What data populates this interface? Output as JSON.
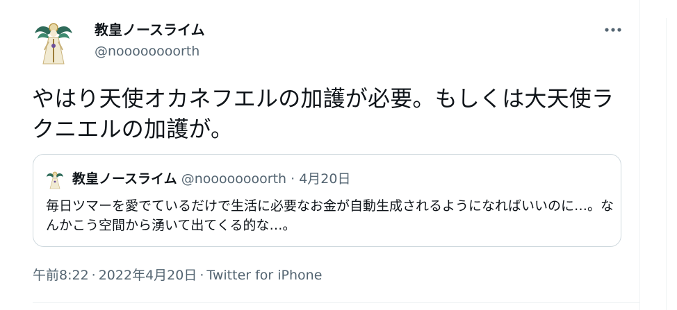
{
  "author": {
    "display_name": "教皇ノースライム",
    "handle": "@noooooooorth",
    "avatar_icon": "angel-figure-avatar"
  },
  "menu": {
    "more_icon": "more-horizontal-icon"
  },
  "tweet": {
    "text": "やはり天使オカネフエルの加護が必要。もしくは大天使ラクニエルの加護が。"
  },
  "quoted_tweet": {
    "display_name": "教皇ノースライム",
    "handle": "@noooooooorth",
    "separator": "·",
    "date": "4月20日",
    "text": "毎日ツマーを愛でているだけで生活に必要なお金が自動生成されるようになればいいのに…。なんかこう空間から湧いて出てくる的な…。"
  },
  "meta": {
    "time": "午前8:22",
    "separator": "·",
    "date": "2022年4月20日",
    "source": "Twitter for iPhone"
  },
  "colors": {
    "text": "#0f1419",
    "secondary": "#536471",
    "border": "#cfd9de",
    "divider": "#eff3f4"
  }
}
